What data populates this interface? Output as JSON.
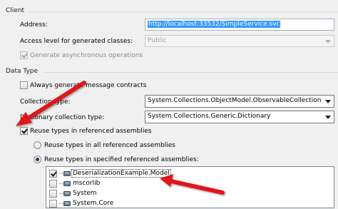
{
  "client": {
    "group_label": "Client",
    "address_label": "Address:",
    "address_value": "http://localhost:33532/SimpleService.svc",
    "access_level_label": "Access level for generated classes:",
    "access_level_value": "Public",
    "generate_async_label": "Generate asynchronous operations",
    "generate_async_checked": true
  },
  "data_type": {
    "group_label": "Data Type",
    "always_generate_message_label": "Always generate message contracts",
    "always_generate_message_checked": false,
    "collection_type_label": "Collection type:",
    "collection_type_value": "System.Collections.ObjectModel.ObservableCollection",
    "dictionary_collection_type_label": "Dictionary collection type:",
    "dictionary_collection_type_value": "System.Collections.Generic.Dictionary",
    "reuse_types_label": "Reuse types in referenced assemblies",
    "reuse_types_checked": true,
    "reuse_all_label": "Reuse types in all referenced assemblies",
    "reuse_specified_label": "Reuse types in specified referenced assemblies:",
    "selected_reuse_option": "specified",
    "assemblies": [
      {
        "name": "DeserializationExample.Model",
        "checked": true
      },
      {
        "name": "mscorlib",
        "checked": false
      },
      {
        "name": "System",
        "checked": false
      },
      {
        "name": "System.Core",
        "checked": false
      }
    ]
  },
  "annotation": {
    "arrow_color": "#e0191b"
  }
}
